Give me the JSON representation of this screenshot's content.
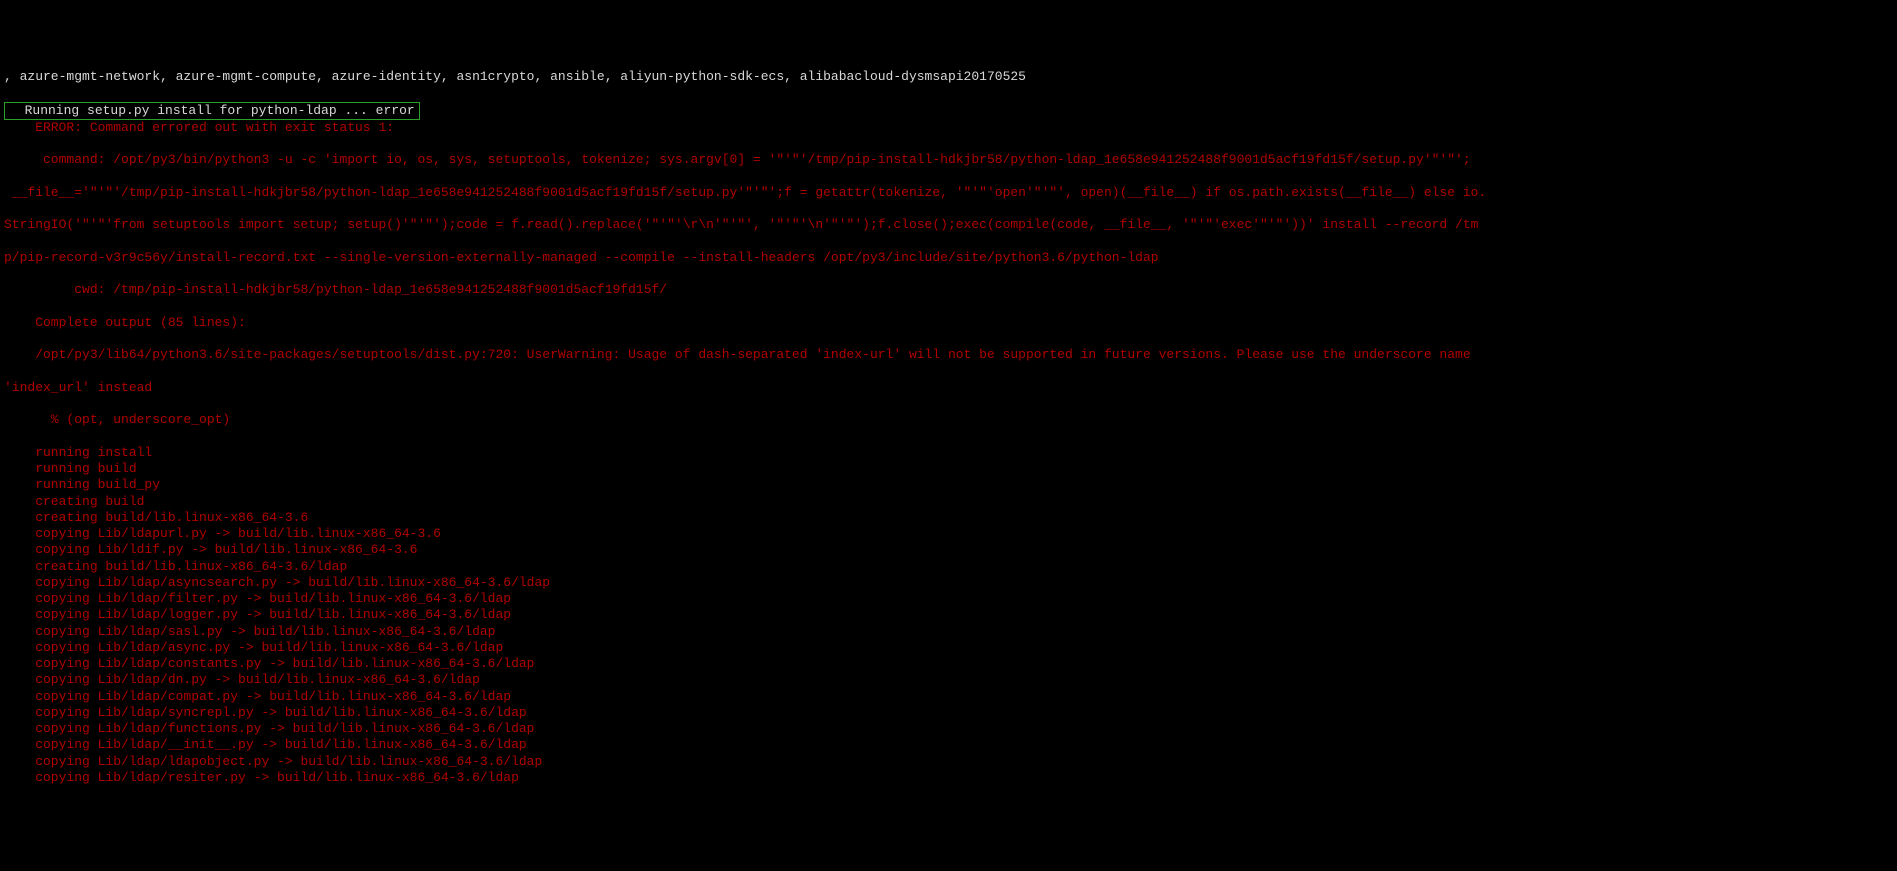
{
  "terminal": {
    "packages": ", azure-mgmt-network, azure-mgmt-compute, azure-identity, asn1crypto, ansible, aliyun-python-sdk-ecs, alibabacloud-dysmsapi20170525",
    "highlight": "  Running setup.py install for python-ldap ... error",
    "error_head": "    ERROR: Command errored out with exit status 1:",
    "cmd1": "     command: /opt/py3/bin/python3 -u -c 'import io, os, sys, setuptools, tokenize; sys.argv[0] = '\"'\"'/tmp/pip-install-hdkjbr58/python-ldap_1e658e941252488f9001d5acf19fd15f/setup.py'\"'\"';",
    "cmd2": " __file__='\"'\"'/tmp/pip-install-hdkjbr58/python-ldap_1e658e941252488f9001d5acf19fd15f/setup.py'\"'\"';f = getattr(tokenize, '\"'\"'open'\"'\"', open)(__file__) if os.path.exists(__file__) else io.",
    "cmd3": "StringIO('\"'\"'from setuptools import setup; setup()'\"'\"');code = f.read().replace('\"'\"'\\r\\n'\"'\"', '\"'\"'\\n'\"'\"');f.close();exec(compile(code, __file__, '\"'\"'exec'\"'\"'))' install --record /tm",
    "cmd4": "p/pip-record-v3r9c56y/install-record.txt --single-version-externally-managed --compile --install-headers /opt/py3/include/site/python3.6/python-ldap",
    "cwd": "         cwd: /tmp/pip-install-hdkjbr58/python-ldap_1e658e941252488f9001d5acf19fd15f/",
    "output_head": "    Complete output (85 lines):",
    "warn1": "    /opt/py3/lib64/python3.6/site-packages/setuptools/dist.py:720: UserWarning: Usage of dash-separated 'index-url' will not be supported in future versions. Please use the underscore name ",
    "warn2": "'index_url' instead",
    "warn3": "      % (opt, underscore_opt)",
    "build": [
      "    running install",
      "    running build",
      "    running build_py",
      "    creating build",
      "    creating build/lib.linux-x86_64-3.6",
      "    copying Lib/ldapurl.py -> build/lib.linux-x86_64-3.6",
      "    copying Lib/ldif.py -> build/lib.linux-x86_64-3.6",
      "    creating build/lib.linux-x86_64-3.6/ldap",
      "    copying Lib/ldap/asyncsearch.py -> build/lib.linux-x86_64-3.6/ldap",
      "    copying Lib/ldap/filter.py -> build/lib.linux-x86_64-3.6/ldap",
      "    copying Lib/ldap/logger.py -> build/lib.linux-x86_64-3.6/ldap",
      "    copying Lib/ldap/sasl.py -> build/lib.linux-x86_64-3.6/ldap",
      "    copying Lib/ldap/async.py -> build/lib.linux-x86_64-3.6/ldap",
      "    copying Lib/ldap/constants.py -> build/lib.linux-x86_64-3.6/ldap",
      "    copying Lib/ldap/dn.py -> build/lib.linux-x86_64-3.6/ldap",
      "    copying Lib/ldap/compat.py -> build/lib.linux-x86_64-3.6/ldap",
      "    copying Lib/ldap/syncrepl.py -> build/lib.linux-x86_64-3.6/ldap",
      "    copying Lib/ldap/functions.py -> build/lib.linux-x86_64-3.6/ldap",
      "    copying Lib/ldap/__init__.py -> build/lib.linux-x86_64-3.6/ldap",
      "    copying Lib/ldap/ldapobject.py -> build/lib.linux-x86_64-3.6/ldap",
      "    copying Lib/ldap/resiter.py -> build/lib.linux-x86_64-3.6/ldap"
    ]
  }
}
